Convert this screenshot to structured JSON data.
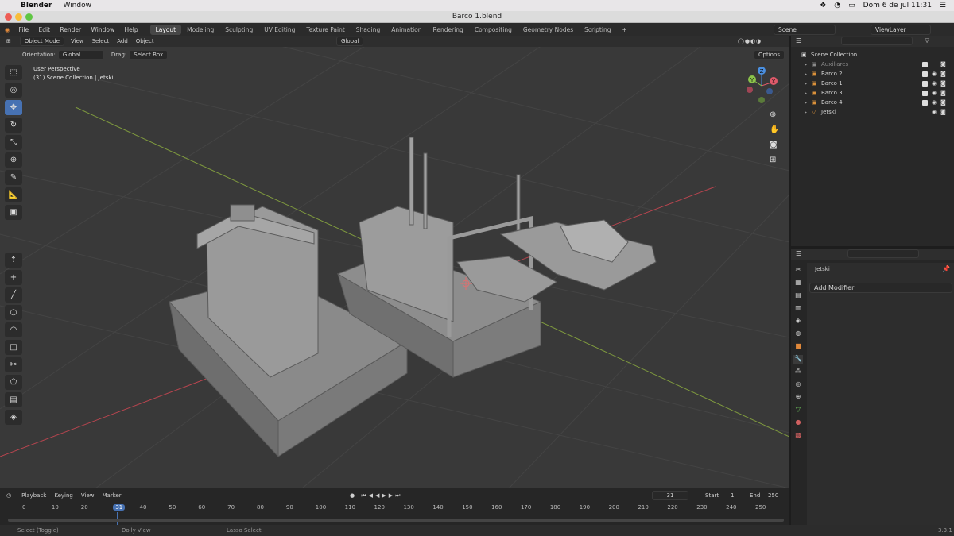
{
  "mac": {
    "app": "Blender",
    "menu": [
      "Window"
    ],
    "datetime": "Dom 6 de jul  11:31"
  },
  "window_title": "Barco 1.blend",
  "top_menu": [
    "File",
    "Edit",
    "Render",
    "Window",
    "Help"
  ],
  "workspaces": [
    "Layout",
    "Modeling",
    "Sculpting",
    "UV Editing",
    "Texture Paint",
    "Shading",
    "Animation",
    "Rendering",
    "Compositing",
    "Geometry Nodes",
    "Scripting"
  ],
  "scene": "Scene",
  "view_layer": "ViewLayer",
  "viewport_header": {
    "mode": "Object Mode",
    "menus": [
      "View",
      "Select",
      "Add",
      "Object"
    ],
    "transform": "Global"
  },
  "toolsettings": {
    "orientation_label": "Orientation:",
    "orientation": "Global",
    "drag_label": "Drag:",
    "drag": "Select Box",
    "options": "Options"
  },
  "overlay_text": {
    "view": "User Perspective",
    "collection": "(31) Scene Collection | Jetski"
  },
  "gizmo": {
    "x": "X",
    "y": "Y",
    "z": "Z"
  },
  "outliner": {
    "root": "Scene Collection",
    "items": [
      {
        "name": "Auxiliares",
        "dim": true
      },
      {
        "name": "Barco 2",
        "dim": false
      },
      {
        "name": "Barco 1",
        "dim": false
      },
      {
        "name": "Barco 3",
        "dim": false
      },
      {
        "name": "Barco 4",
        "dim": false
      },
      {
        "name": "Jetski",
        "dim": false
      }
    ]
  },
  "properties": {
    "object": "Jetski",
    "add_modifier": "Add Modifier"
  },
  "timeline": {
    "menus": [
      "Playback",
      "Keying",
      "View",
      "Marker"
    ],
    "current": "31",
    "start_label": "Start",
    "start": "1",
    "end_label": "End",
    "end": "250",
    "ticks": [
      "0",
      "10",
      "20",
      "31",
      "40",
      "50",
      "60",
      "70",
      "80",
      "90",
      "100",
      "110",
      "120",
      "130",
      "140",
      "150",
      "160",
      "170",
      "180",
      "190",
      "200",
      "210",
      "220",
      "230",
      "240",
      "250"
    ]
  },
  "status": {
    "select": "Select (Toggle)",
    "dolly": "Dolly View",
    "lasso": "Lasso Select",
    "version": "3.3.1"
  },
  "colors": {
    "accent": "#4772b3",
    "x_axis": "#e05a6a",
    "y_axis": "#8bc34a",
    "z_axis": "#4a8fe0"
  }
}
